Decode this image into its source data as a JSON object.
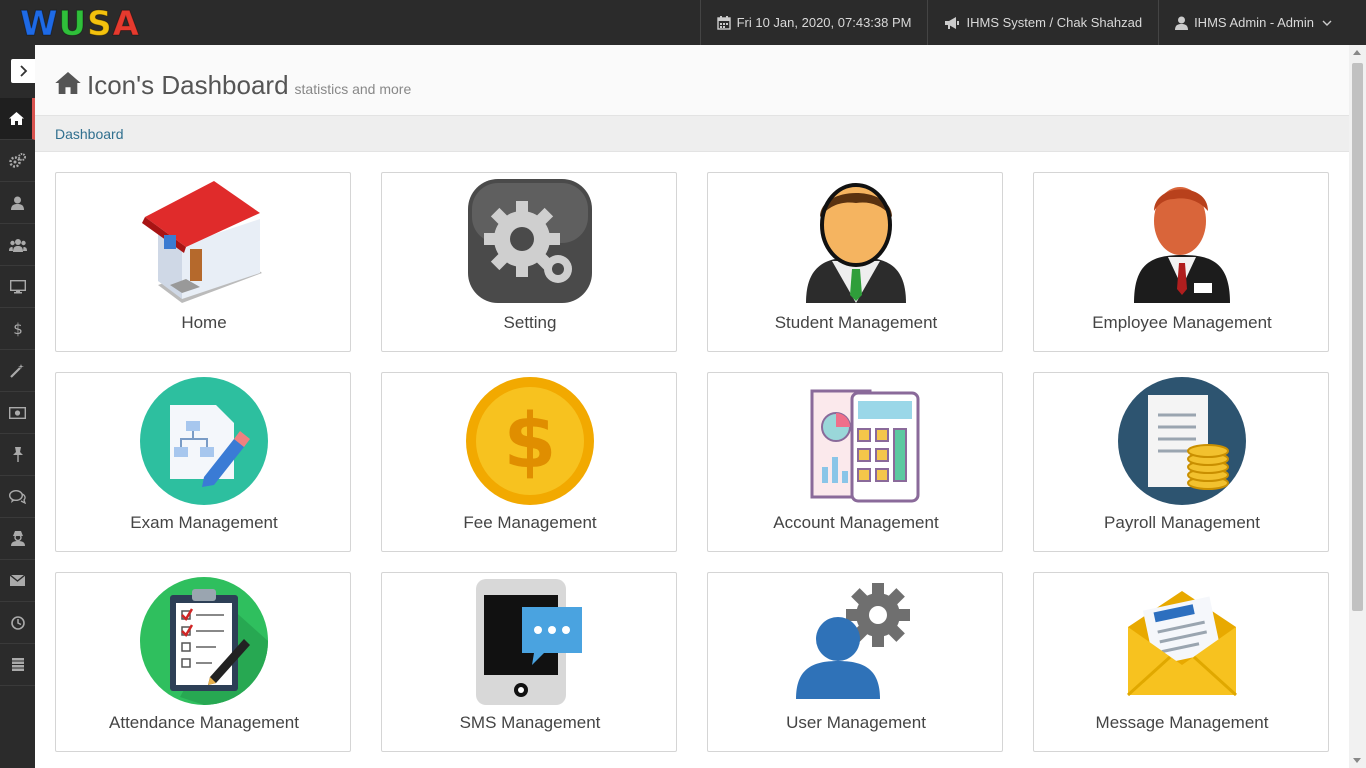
{
  "app": {
    "logo_letters": [
      "W",
      "U",
      "S",
      "A"
    ],
    "logo_colors": [
      "#1e6ae6",
      "#2fbf3a",
      "#f4c20d",
      "#e63a2e"
    ]
  },
  "topbar": {
    "datetime": "Fri 10 Jan, 2020, 07:43:38 PM",
    "system": "IHMS System / Chak Shahzad",
    "user": "IHMS Admin - Admin"
  },
  "page": {
    "title": "Icon's Dashboard",
    "subtitle": "statistics and more",
    "breadcrumb": "Dashboard"
  },
  "sidebar": {
    "items": [
      {
        "icon": "home-icon"
      },
      {
        "icon": "cogs-icon"
      },
      {
        "icon": "user-icon"
      },
      {
        "icon": "users-icon"
      },
      {
        "icon": "desktop-icon"
      },
      {
        "icon": "dollar-icon"
      },
      {
        "icon": "magic-wand-icon"
      },
      {
        "icon": "money-icon"
      },
      {
        "icon": "pushpin-icon"
      },
      {
        "icon": "comments-icon"
      },
      {
        "icon": "user-secret-icon"
      },
      {
        "icon": "envelope-icon"
      },
      {
        "icon": "clock-icon"
      },
      {
        "icon": "list-icon"
      }
    ]
  },
  "tiles": [
    {
      "label": "Home",
      "icon": "house-icon"
    },
    {
      "label": "Setting",
      "icon": "gear-icon"
    },
    {
      "label": "Student Management",
      "icon": "student-icon"
    },
    {
      "label": "Employee Management",
      "icon": "employee-icon"
    },
    {
      "label": "Exam Management",
      "icon": "exam-icon"
    },
    {
      "label": "Fee Management",
      "icon": "coin-icon"
    },
    {
      "label": "Account Management",
      "icon": "calculator-icon"
    },
    {
      "label": "Payroll Management",
      "icon": "payroll-icon"
    },
    {
      "label": "Attendance Management",
      "icon": "clipboard-icon"
    },
    {
      "label": "SMS Management",
      "icon": "phone-icon"
    },
    {
      "label": "User Management",
      "icon": "user-gear-icon"
    },
    {
      "label": "Message Management",
      "icon": "mail-icon"
    }
  ],
  "colors": {
    "topbar": "#2b2b2b",
    "sidebar_active_marker": "#d9534f",
    "breadcrumb_link": "#31708f"
  }
}
